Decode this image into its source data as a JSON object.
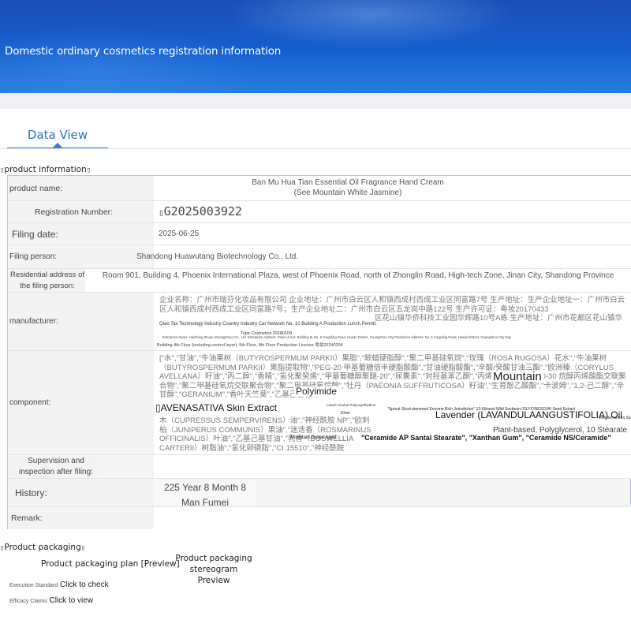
{
  "banner": {
    "title": "Domestic ordinary cosmetics registration information"
  },
  "tabs": [
    {
      "label": "Data View"
    }
  ],
  "sections": {
    "product_info": {
      "label": "product information"
    },
    "packaging": {
      "label": "Product packaging"
    }
  },
  "fields": {
    "product_name": {
      "label": "product name:",
      "value": "Ban Mu Hua Tian Essential Oil Fragrance Hand Cream (See Mountain White Jasmine)"
    },
    "registration_number": {
      "label": "Registration Number:",
      "value": "G2025003922"
    },
    "filing_date": {
      "label": "Filing date:",
      "value": "2025-06-25"
    },
    "filing_person": {
      "label": "Filing person:",
      "value": "Shandong Huawutang Biotechnology Co., Ltd."
    },
    "residential_address": {
      "label": "Residential address of the filing person:",
      "value": "Room 901, Building 4, Phoenix International Plaza, west of Phoenix Road, north of Zhonglin Road, High-tech Zone, Jinan City, Shandong Province"
    },
    "manufacturer": {
      "label": "manufacturer:",
      "value_cn_1": "企业名称：广州市瑞芬化妆品有限公司 企业地址：广州市白云区人和镇西成村西成工业区同富路7号 生产地址：生产企业地址一：广州市白云区人和镇西成村西成工业区同富路7号；生产企业地址二：广州市白云区五龙岗中路122号 生产许可证：粤妆20170433",
      "value_cn_2": "区花山镇华侨科技工业园华辉路10号A栋 生产地址：广州市花都区花山镇华",
      "value_en_1": "Qiao Tax Technology Industry Country Industry Car Network No. 10 Building A Production Lunch Permit:",
      "value_en_2": "Enterprise Name: Haizhong Zhuye (Guangzhou) Co., Ltd. Enterprise Address: Room 4 to 6, Building B, No. 6 Cuiguling Road, Huadu District, Guangzhou City Production Address: No. 6 Cuiguling Road, Huadu District, Guangzhou City Day",
      "value_en_3": "Type Cosmetics 20180109",
      "value_en_4": "Building 4th Floor (including control layer), 5th Floor, 8th Floor Production License 粤妆20240254"
    },
    "component": {
      "label": "component:",
      "value_cn_1": "[\"水\",\"甘油\",\"牛油果树（BUTYROSPERMUM PARKII）果脂\",\"鲸蜡硬脂醇\",\"聚二甲基硅氧烷\",\"玫瑰（ROSA RUGOSA）花水\",\"牛油果树（BUTYROSPERMUM PARKII）果脂提取物\",\"PEG-20 甲基葡糖倍半硬脂酸酯\",\"甘油硬脂酸酯\",\"辛酸/癸酸甘油三酯\",\"欧洲榛（CORYLUS AVELLANA）籽油\",\"丙二醇\",\"香精\",\"氢化聚癸烯\",\"甲基葡糖醇聚醚-20\",\"尿囊素\",\"对羟基苯乙酮\",\"丙烯酸（酯）类/C10-30 烷醇丙烯酸酯交联聚合物\",\"聚二甲基硅氧烷交联聚合物\",\"聚二甲基硅氧烷醇\",\"牡丹（PAEONIA SUFFRUTICOSA）籽油\",\"生育酚乙酸酯\",\"卡波姆\",\"1,2-己二醇\",\"辛甘醇\",\"GERANIUM\",\"香叶天竺葵\",\"乙基己基甘油\"",
      "value_cn_2": "木（CUPRESSUS SEMPERVIRENS）油\",\"神经酰胺 NP\",\"欧刺柏（JUNIPERUS COMMUNIS）果油\",\"迷迭香（ROSMARINUS OFFICINALIS）叶油\",\"乙基己基甘油\",\"乳香（BOSWELLIA CARTERII）树脂油\",\"氢化卵磷脂\",\"CI 15510\",\"神经酰胺 EOP\",\"野大豆（GLYCINE SOJA）油\"]",
      "value_en_polyimide": "Polyimide",
      "value_en_mountain": "Mountain",
      "value_en_avena": "AVENASATIVA Skin Extract",
      "value_en_lavender": "Lavender (LAVANDULAANGUSTIFOLIA) Oil",
      "value_en_plant": "Plant-based, Polyglycerol, 10 Stearate",
      "value_en_ceramide": "\"Ceramide AP Santal Stearate\", \"Xanthan Gum\", \"Ceramide NS/Ceramide\"",
      "value_en_grape": "Mountain Grape Aged",
      "value_en_sprout": "\"Sprout Short-stemmed Enzyme Rich Jurisdiction\" 12-Ethanol Wild Soybean (GLYCINESOJA) Seed Extract",
      "value_en_laurel": "Laurel Alcohol Polyoxyethylene",
      "value_en_ether": "Ether",
      "value_en_mediterranean": "Mediterranean Spe"
    },
    "supervision": {
      "label": "Supervision and inspection after filing:",
      "value": ""
    },
    "history": {
      "label": "History:",
      "value": "225 Year 8 Month 8 Man Fumei"
    },
    "remark": {
      "label": "Remark:",
      "value": ""
    }
  },
  "packaging": {
    "plan_label": "Product packaging plan [Preview]",
    "stereogram_label": "Product packaging stereogram Preview",
    "links": [
      {
        "prefix": "Execution Standard",
        "text": "Click to check"
      },
      {
        "prefix": "Efficacy Claims",
        "text": "Click to view"
      }
    ]
  }
}
